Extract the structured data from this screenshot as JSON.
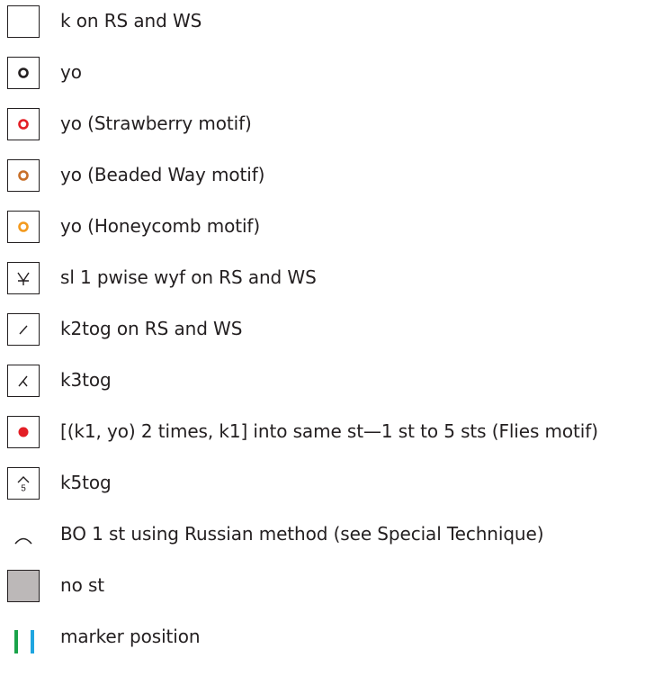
{
  "legend": {
    "items": [
      {
        "label": "k on RS and WS",
        "symbol": "empty-square-icon"
      },
      {
        "label": "yo",
        "symbol": "circle-icon",
        "color": "#231f20"
      },
      {
        "label": "yo (Strawberry motif)",
        "symbol": "circle-icon",
        "color": "#e31e25"
      },
      {
        "label": "yo (Beaded Way motif)",
        "symbol": "circle-icon",
        "color": "#c8702a"
      },
      {
        "label": "yo (Honeycomb motif)",
        "symbol": "circle-icon",
        "color": "#f39a1e"
      },
      {
        "label": "sl 1 pwise wyf on RS and WS",
        "symbol": "slip-stitch-icon"
      },
      {
        "label": "k2tog on RS and WS",
        "symbol": "k2tog-icon"
      },
      {
        "label": "k3tog",
        "symbol": "k3tog-icon"
      },
      {
        "label": "[(k1, yo) 2 times, k1] into same st—1 st to 5 sts (Flies motif)",
        "symbol": "filled-dot-icon",
        "color": "#e31e25"
      },
      {
        "label": "k5tog",
        "symbol": "k5tog-icon",
        "glyph": "5"
      },
      {
        "label": "BO 1 st using Russian method (see Special Technique)",
        "symbol": "arc-icon"
      },
      {
        "label": "no st",
        "symbol": "gray-square-icon",
        "color": "#bcb8b8"
      },
      {
        "label": "marker position",
        "symbol": "marker-lines-icon",
        "colors": [
          "#1aa34a",
          "#1fa5e0"
        ]
      }
    ]
  }
}
